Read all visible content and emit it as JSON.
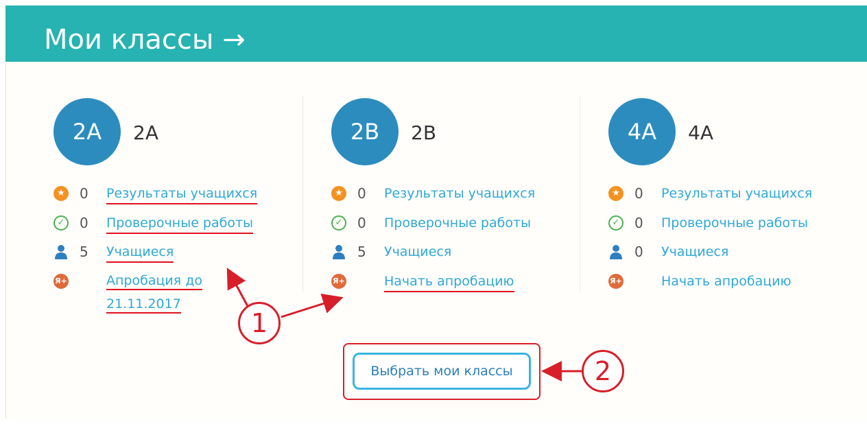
{
  "header": {
    "title": "Мои классы →"
  },
  "classes": [
    {
      "avatar": "2А",
      "name": "2А",
      "results": {
        "count": "0",
        "label": "Результаты учащихся"
      },
      "tests": {
        "count": "0",
        "label": "Проверочные работы"
      },
      "students": {
        "count": "5",
        "label": "Учащиеся"
      },
      "pilot": {
        "label": "Апробация до 21.11.2017"
      }
    },
    {
      "avatar": "2В",
      "name": "2В",
      "results": {
        "count": "0",
        "label": "Результаты учащихся"
      },
      "tests": {
        "count": "0",
        "label": "Проверочные работы"
      },
      "students": {
        "count": "5",
        "label": "Учащиеся"
      },
      "pilot": {
        "label": "Начать апробацию"
      }
    },
    {
      "avatar": "4А",
      "name": "4А",
      "results": {
        "count": "0",
        "label": "Результаты учащихся"
      },
      "tests": {
        "count": "0",
        "label": "Проверочные работы"
      },
      "students": {
        "count": "0",
        "label": "Учащиеся"
      },
      "pilot": {
        "label": "Начать апробацию"
      }
    }
  ],
  "select_button": {
    "label": "Выбрать мои классы"
  },
  "icons": {
    "results": "star-badge-icon",
    "tests": "check-circle-icon",
    "students": "user-icon",
    "pilot": "yandex-pilot-icon"
  },
  "annotations": {
    "callout_1": "1",
    "callout_2": "2"
  },
  "colors": {
    "header": "#26b3b1",
    "avatar": "#2c8cbe",
    "link": "#2fa8d8",
    "annotation": "#d81e29"
  }
}
